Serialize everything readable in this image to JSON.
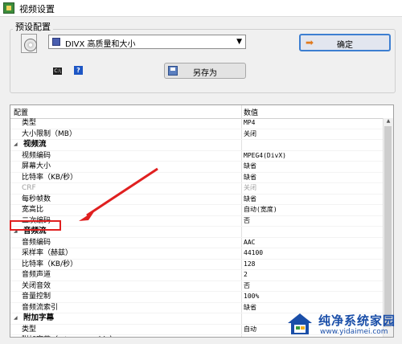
{
  "window": {
    "title": "视频设置"
  },
  "preset": {
    "group_label": "预设配置",
    "selected": "DIVX 高质量和大小",
    "ok_label": "确定",
    "saveas_label": "另存为",
    "cmd_icon_text": "C:\\",
    "help_icon_text": "?"
  },
  "grid": {
    "header": {
      "name": "配置",
      "value": "数值"
    },
    "rows": [
      {
        "kind": "item",
        "name": "类型",
        "value": "MP4"
      },
      {
        "kind": "item",
        "name": "大小限制（MB）",
        "value": "关闭"
      },
      {
        "kind": "cat",
        "name": "视频流",
        "value": ""
      },
      {
        "kind": "item",
        "name": "视频编码",
        "value": "MPEG4(DivX)"
      },
      {
        "kind": "item",
        "name": "屏幕大小",
        "value": "缺省"
      },
      {
        "kind": "item",
        "name": "比特率（KB/秒）",
        "value": "缺省"
      },
      {
        "kind": "disabled",
        "name": "CRF",
        "value": "关闭"
      },
      {
        "kind": "item",
        "name": "每秒帧数",
        "value": "缺省"
      },
      {
        "kind": "item",
        "name": "宽高比",
        "value": "自动(宽度)"
      },
      {
        "kind": "item",
        "name": "二次编码",
        "value": "否"
      },
      {
        "kind": "cat",
        "name": "音频流",
        "value": ""
      },
      {
        "kind": "item",
        "name": "音频编码",
        "value": "AAC"
      },
      {
        "kind": "item",
        "name": "采样率（赫兹）",
        "value": "44100"
      },
      {
        "kind": "item",
        "name": "比特率（KB/秒）",
        "value": "128"
      },
      {
        "kind": "item",
        "name": "音频声道",
        "value": "2"
      },
      {
        "kind": "item",
        "name": "关闭音效",
        "value": "否"
      },
      {
        "kind": "item",
        "name": "音量控制",
        "value": "100%"
      },
      {
        "kind": "item",
        "name": "音频流索引",
        "value": "缺省"
      },
      {
        "kind": "cat",
        "name": "附加字幕",
        "value": ""
      },
      {
        "kind": "item",
        "name": "类型",
        "value": "自动"
      },
      {
        "kind": "item",
        "name": "附加字幕（srt;ass;ssa;idx）",
        "value": ""
      }
    ]
  },
  "watermark": {
    "title": "纯净系统家园",
    "url": "www.yidaimei.com"
  },
  "colors": {
    "highlight": "#e02020",
    "accent": "#3d7fd1"
  }
}
